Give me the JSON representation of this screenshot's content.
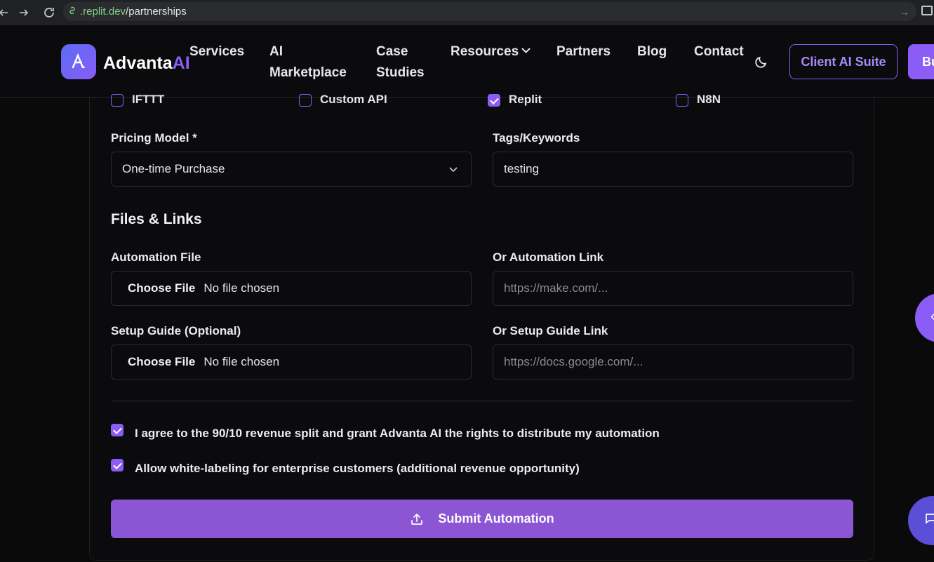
{
  "browser": {
    "url_host": ".replit.dev",
    "url_path": "/partnerships"
  },
  "header": {
    "brand_main": "Advanta",
    "brand_accent": "AI",
    "nav": {
      "services": "Services",
      "ai_marketplace_1": "AI",
      "ai_marketplace_2": "Marketplace",
      "case_studies_1": "Case",
      "case_studies_2": "Studies",
      "resources": "Resources",
      "partners": "Partners",
      "blog": "Blog",
      "contact": "Contact"
    },
    "client_button": "Client AI Suite",
    "cta_button": "Bu"
  },
  "form": {
    "platforms": [
      {
        "label": "IFTTT",
        "checked": false
      },
      {
        "label": "Custom API",
        "checked": false
      },
      {
        "label": "Replit",
        "checked": true
      },
      {
        "label": "N8N",
        "checked": false
      }
    ],
    "pricing_label": "Pricing Model *",
    "pricing_value": "One-time Purchase",
    "tags_label": "Tags/Keywords",
    "tags_value": "testing",
    "files_section_title": "Files & Links",
    "automation_file_label": "Automation File",
    "automation_link_label": "Or Automation Link",
    "automation_link_placeholder": "https://make.com/...",
    "setup_guide_label": "Setup Guide (Optional)",
    "setup_guide_link_label": "Or Setup Guide Link",
    "setup_guide_link_placeholder": "https://docs.google.com/...",
    "choose_file": "Choose File",
    "no_file": "No file chosen",
    "agree_revenue": "I agree to the 90/10 revenue split and grant Advanta AI the rights to distribute my automation",
    "agree_whitelabel": "Allow white-labeling for enterprise customers (additional revenue opportunity)",
    "submit_label": "Submit Automation"
  },
  "colors": {
    "accent": "#8b5cf6",
    "submit": "#8b55d4",
    "background": "#0a0a0b"
  },
  "icons": [
    "back-arrow-icon",
    "forward-arrow-icon",
    "reload-icon",
    "link-icon",
    "moon-icon",
    "chevron-down-icon",
    "upload-icon",
    "chat-icon"
  ]
}
